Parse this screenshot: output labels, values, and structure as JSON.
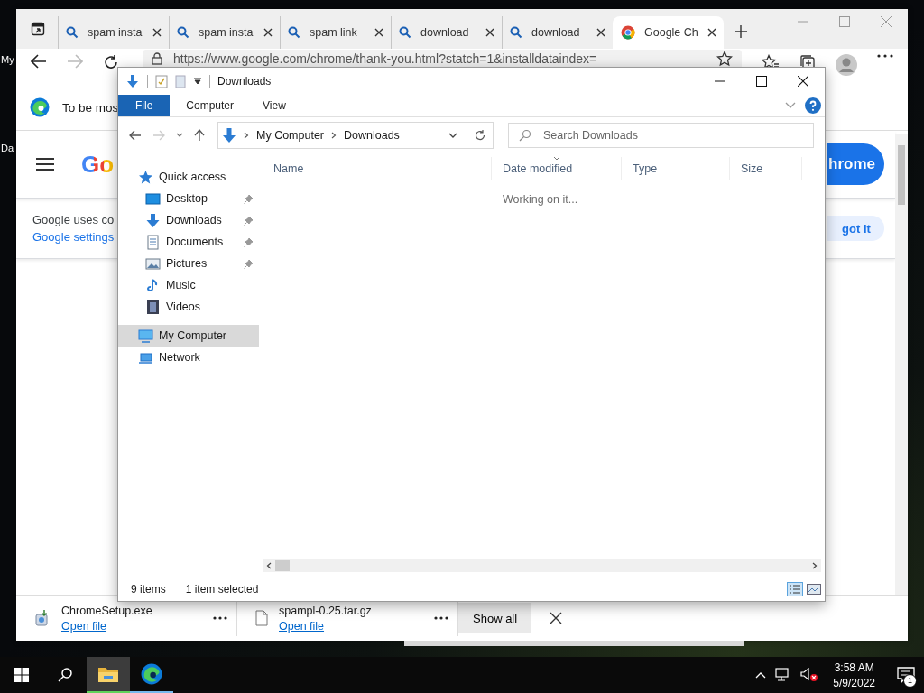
{
  "desktop": {
    "icon_labels": [
      "My",
      "Da"
    ]
  },
  "browser": {
    "tabs": [
      {
        "title": "spam insta",
        "kind": "search",
        "selected": false
      },
      {
        "title": "spam insta",
        "kind": "search",
        "selected": false
      },
      {
        "title": "spam link",
        "kind": "search",
        "selected": false
      },
      {
        "title": "download",
        "kind": "search",
        "selected": false
      },
      {
        "title": "download",
        "kind": "search",
        "selected": false
      },
      {
        "title": "Google Ch",
        "kind": "chrome",
        "selected": true
      }
    ],
    "address": "https://www.google.com/chrome/thank-you.html?statch=1&installdataindex=",
    "info_bar": "To be mos",
    "page": {
      "logo": "Go",
      "cookie_text": "Google uses co",
      "cookie_link": "Google settings",
      "download_button": "hrome",
      "got_it_button": "got it"
    },
    "downloads": [
      {
        "file": "ChromeSetup.exe",
        "action": "Open file",
        "kind": "installer"
      },
      {
        "file": "spampl-0.25.tar.gz",
        "action": "Open file",
        "kind": "file"
      }
    ],
    "show_all": "Show all"
  },
  "explorer": {
    "title": "Downloads",
    "ribbon_tabs": [
      {
        "label": "File",
        "selected": true
      },
      {
        "label": "Computer",
        "selected": false
      },
      {
        "label": "View",
        "selected": false
      }
    ],
    "breadcrumb": [
      "My Computer",
      "Downloads"
    ],
    "search": {
      "placeholder": "Search Downloads"
    },
    "nav": [
      {
        "label": "Quick access",
        "kind": "star",
        "selected": false,
        "children": [
          {
            "label": "Desktop",
            "kind": "desktop",
            "pinned": true,
            "selected": false
          },
          {
            "label": "Downloads",
            "kind": "downloads",
            "pinned": true,
            "selected": false
          },
          {
            "label": "Documents",
            "kind": "documents",
            "pinned": true,
            "selected": false
          },
          {
            "label": "Pictures",
            "kind": "pictures",
            "pinned": true,
            "selected": false
          },
          {
            "label": "Music",
            "kind": "music",
            "pinned": false,
            "selected": false
          },
          {
            "label": "Videos",
            "kind": "videos",
            "pinned": false,
            "selected": false
          }
        ]
      },
      {
        "label": "My Computer",
        "kind": "computer",
        "selected": true
      },
      {
        "label": "Network",
        "kind": "network",
        "selected": false
      }
    ],
    "columns": [
      {
        "label": "Name",
        "sorted": false
      },
      {
        "label": "Date modified",
        "sorted": true
      },
      {
        "label": "Type",
        "sorted": false
      },
      {
        "label": "Size",
        "sorted": false
      }
    ],
    "loading_text": "Working on it...",
    "status": {
      "items": "9 items",
      "selection": "1 item selected"
    }
  },
  "taskbar": {
    "apps": [
      {
        "kind": "explorer",
        "active": true
      },
      {
        "kind": "edge",
        "active": false
      }
    ],
    "time": "3:58 AM",
    "date": "5/9/2022",
    "notification_count": "1"
  }
}
